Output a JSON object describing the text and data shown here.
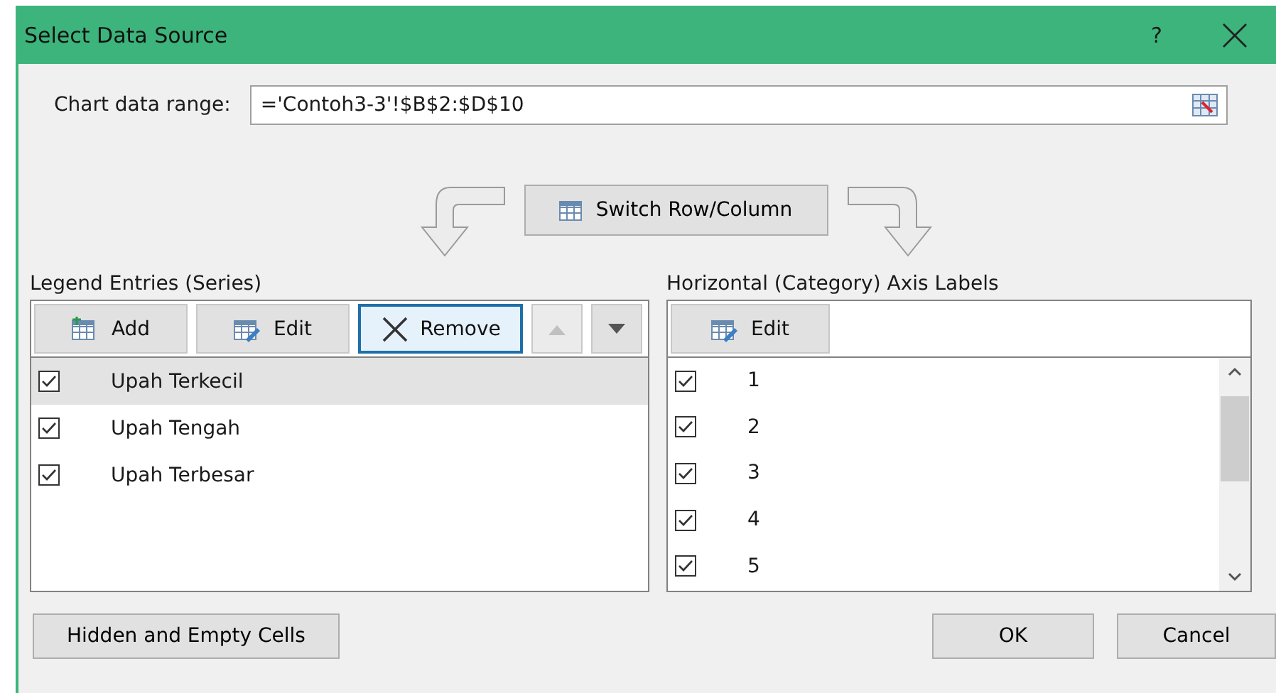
{
  "window": {
    "title": "Select Data Source",
    "help": "?"
  },
  "data_range": {
    "label": "Chart data range:",
    "value": "='Contoh3-3'!$B$2:$D$10"
  },
  "switch_button": "Switch Row/Column",
  "legend": {
    "label": "Legend Entries (Series)",
    "buttons": [
      {
        "label": "Add",
        "kind": "add",
        "focused": false,
        "disabled": false
      },
      {
        "label": "Edit",
        "kind": "edit",
        "focused": false,
        "disabled": false
      },
      {
        "label": "Remove",
        "kind": "remove",
        "focused": true,
        "disabled": false
      },
      {
        "kind": "up",
        "focused": false,
        "disabled": true
      },
      {
        "kind": "down",
        "focused": false,
        "disabled": false
      }
    ],
    "items": [
      {
        "label": "Upah Terkecil",
        "checked": true,
        "selected": true
      },
      {
        "label": "Upah Tengah",
        "checked": true,
        "selected": false
      },
      {
        "label": "Upah Terbesar",
        "checked": true,
        "selected": false
      }
    ]
  },
  "axis": {
    "label": "Horizontal (Category) Axis Labels",
    "edit_button": "Edit",
    "items": [
      {
        "label": "1",
        "checked": true
      },
      {
        "label": "2",
        "checked": true
      },
      {
        "label": "3",
        "checked": true
      },
      {
        "label": "4",
        "checked": true
      },
      {
        "label": "5",
        "checked": true
      }
    ]
  },
  "footer": {
    "hidden_button": "Hidden and Empty Cells",
    "ok": "OK",
    "cancel": "Cancel"
  }
}
